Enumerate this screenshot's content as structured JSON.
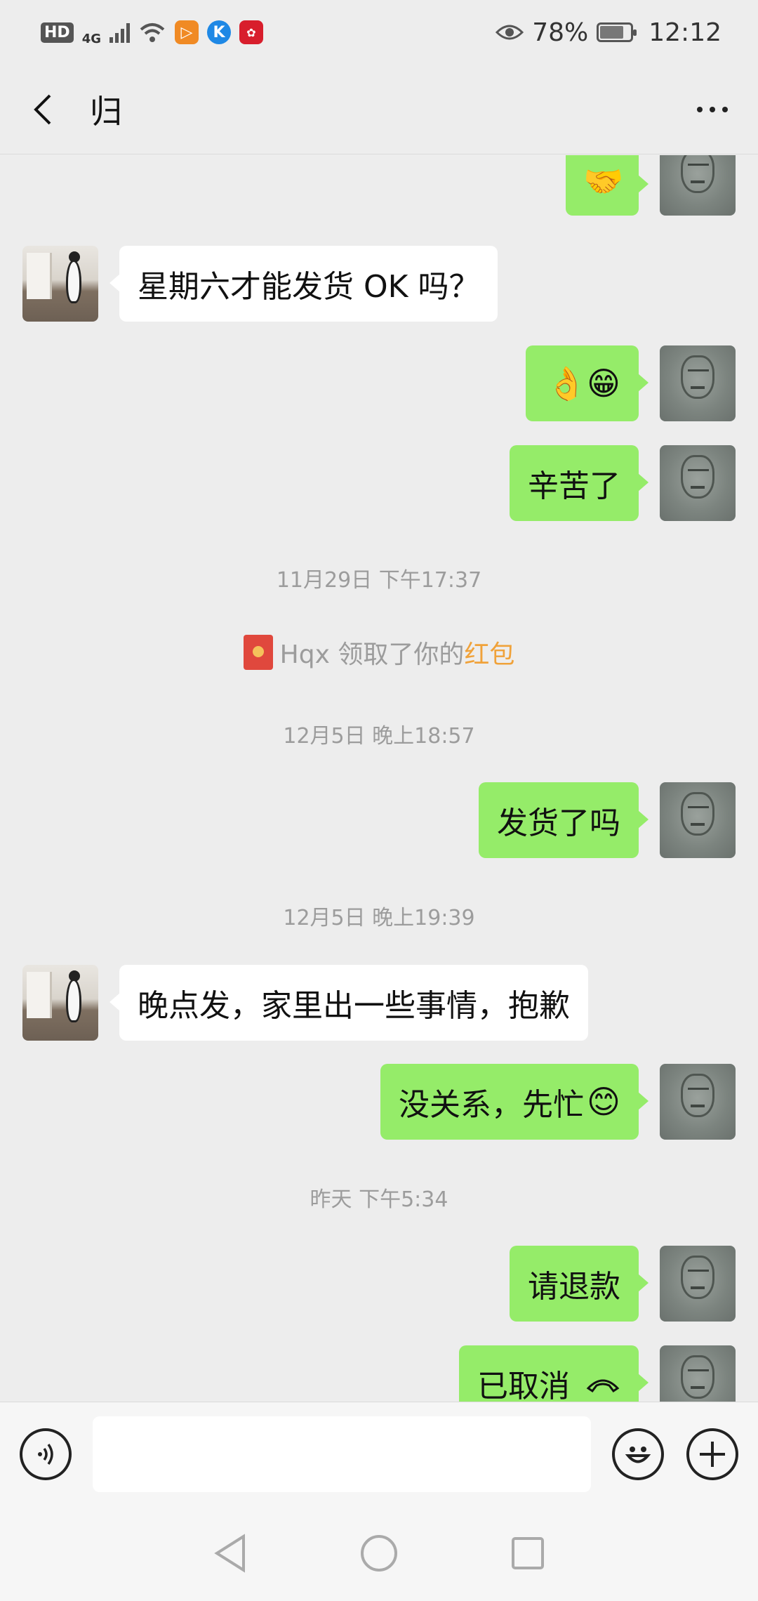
{
  "status": {
    "hd": "HD",
    "network": "4G",
    "battery": "78%",
    "battery_level": 0.78,
    "time": "12:12"
  },
  "header": {
    "title": "归"
  },
  "messages": {
    "m1_emoji": "🤝",
    "m2_text": "星期六才能发货 OK 吗？",
    "m3_emoji": "👌😁",
    "m4_text": "辛苦了",
    "ts1": "11月29日 下午17:37",
    "note_sender": "Hqx 领取了你的",
    "note_highlight": "红包",
    "ts2": "12月5日 晚上18:57",
    "m5_text": "发货了吗",
    "ts3": "12月5日 晚上19:39",
    "m6_text": "晚点发，家里出一些事情，抱歉",
    "m7_text": "没关系，先忙",
    "m7_emoji": "😊",
    "ts4": "昨天 下午5:34",
    "m8_text": "请退款",
    "m9_text": "已取消"
  },
  "colors": {
    "my_bubble": "#95ec69",
    "other_bubble": "#ffffff",
    "background": "#ededed",
    "highlight": "#f0a23a"
  },
  "icons": [
    "back-arrow-icon",
    "more-icon",
    "voice-icon",
    "emoji-icon",
    "plus-icon",
    "red-packet-icon",
    "phone-hangup-icon",
    "nav-back-icon",
    "nav-home-icon",
    "nav-recent-icon"
  ]
}
